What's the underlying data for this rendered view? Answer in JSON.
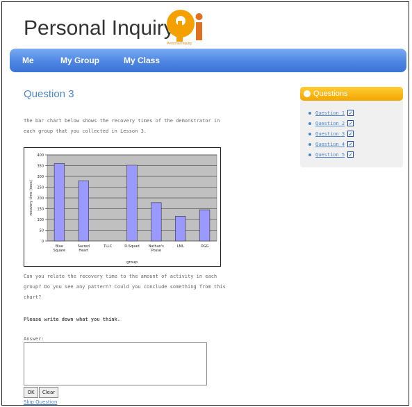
{
  "site": {
    "title": "Personal Inquiry",
    "logo_text": "Personal Inquiry",
    "logo_letters": "Pi",
    "brand_color": "#f4a000"
  },
  "nav": {
    "items": [
      {
        "label": "Me"
      },
      {
        "label": "My Group"
      },
      {
        "label": "My Class"
      }
    ]
  },
  "question": {
    "title": "Question 3",
    "intro_line1": "The bar chart below shows the recovery times of the demonstrator in",
    "intro_line2": "each group that you collected in Lesson 3.",
    "body_line1": "Can you relate the recovery time to the amount of activity in each",
    "body_line2": "group? Do you see any pattern? Could you conclude something from this",
    "body_line3": "chart?",
    "prompt": "Please write down what you think.",
    "answer_label": "Answer:",
    "answer_value": "",
    "ok_label": "OK",
    "clear_label": "Clear",
    "skip_label": "Skip Question"
  },
  "sidebar": {
    "heading": "Questions",
    "items": [
      {
        "label": "Question 1",
        "checked": true
      },
      {
        "label": "Question 2",
        "checked": true
      },
      {
        "label": "Question 3",
        "checked": true
      },
      {
        "label": "Question 4",
        "checked": true
      },
      {
        "label": "Question 5",
        "checked": true
      }
    ]
  },
  "chart_data": {
    "type": "bar",
    "categories": [
      "Blue Square",
      "Sacred Heart",
      "TLLC",
      "D-Squad",
      "Nathan's Posse",
      "LML",
      "OGG"
    ],
    "values": [
      360,
      280,
      0,
      352,
      178,
      115,
      145
    ],
    "xlabel": "group",
    "ylabel": "recovery time (secs)",
    "ylim": [
      0,
      400
    ],
    "yticks": [
      0,
      50,
      100,
      150,
      200,
      250,
      300,
      350,
      400
    ],
    "grid": true,
    "bar_color": "#9999ff",
    "plot_bg": "#c0c0c0"
  }
}
